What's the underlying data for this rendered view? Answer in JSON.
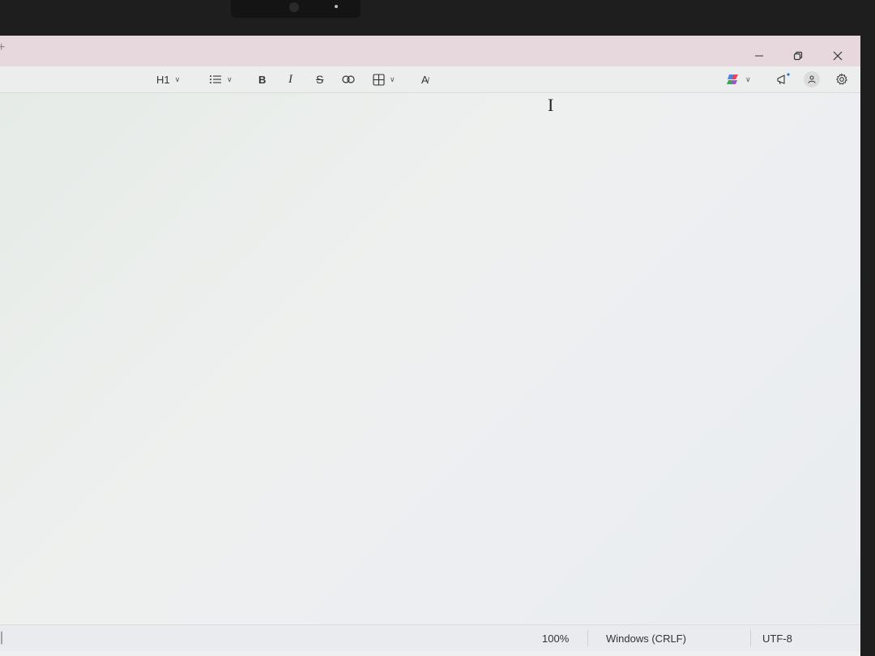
{
  "toolbar": {
    "heading_label": "H1",
    "bold_label": "B",
    "italic_label": "I",
    "strike_label": "S",
    "format_clear_label": "A"
  },
  "statusbar": {
    "zoom": "100%",
    "line_ending": "Windows (CRLF)",
    "encoding": "UTF-8"
  },
  "icons": {
    "minimize": "minimize-icon",
    "restore": "restore-icon",
    "close": "close-icon",
    "list": "bulleted-list-icon",
    "link": "link-icon",
    "table": "table-icon",
    "clear_format": "clear-formatting-icon",
    "copilot": "copilot-icon",
    "announce": "megaphone-icon",
    "account": "account-icon",
    "settings": "gear-icon",
    "cursor": "text-cursor-icon"
  },
  "colors": {
    "titlebar": "#e6d8dc",
    "editor": "#eef0ef",
    "text": "#333333"
  }
}
